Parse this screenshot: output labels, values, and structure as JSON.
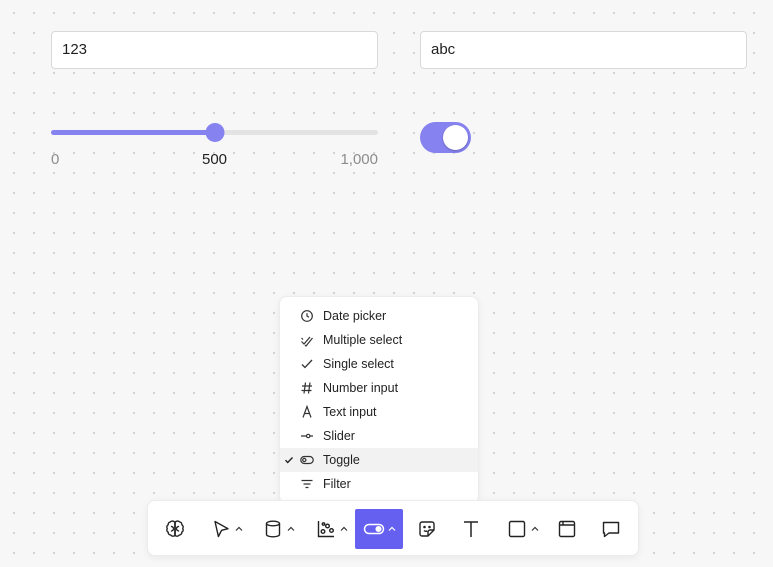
{
  "inputs": {
    "number_value": "123",
    "text_value": "abc"
  },
  "slider": {
    "min_label": "0",
    "value_label": "500",
    "max_label": "1,000",
    "min": 0,
    "max": 1000,
    "value": 500,
    "color": "#8683f1"
  },
  "toggle": {
    "on": true,
    "color": "#8683f1"
  },
  "menu": {
    "selected_index": 6,
    "items": [
      {
        "label": "Date picker",
        "icon": "clock-icon"
      },
      {
        "label": "Multiple select",
        "icon": "double-check-icon"
      },
      {
        "label": "Single select",
        "icon": "check-icon"
      },
      {
        "label": "Number input",
        "icon": "hash-icon"
      },
      {
        "label": "Text input",
        "icon": "letter-a-icon"
      },
      {
        "label": "Slider",
        "icon": "slider-icon"
      },
      {
        "label": "Toggle",
        "icon": "toggle-icon"
      },
      {
        "label": "Filter",
        "icon": "filter-icon"
      }
    ]
  },
  "toolbar": {
    "active_tool": "input-controls",
    "accent_color": "#6560f0",
    "tools": [
      {
        "name": "ai-brain",
        "icon": "brain-icon"
      },
      {
        "name": "select",
        "icon": "cursor-icon"
      },
      {
        "name": "data",
        "icon": "database-icon"
      },
      {
        "name": "chart",
        "icon": "chart-icon"
      },
      {
        "name": "input-controls",
        "icon": "toggle-icon"
      },
      {
        "name": "sticker",
        "icon": "sticker-icon"
      },
      {
        "name": "text",
        "icon": "text-icon"
      },
      {
        "name": "shape",
        "icon": "square-icon"
      },
      {
        "name": "frame",
        "icon": "frame-icon"
      },
      {
        "name": "comment",
        "icon": "comment-icon"
      }
    ]
  }
}
